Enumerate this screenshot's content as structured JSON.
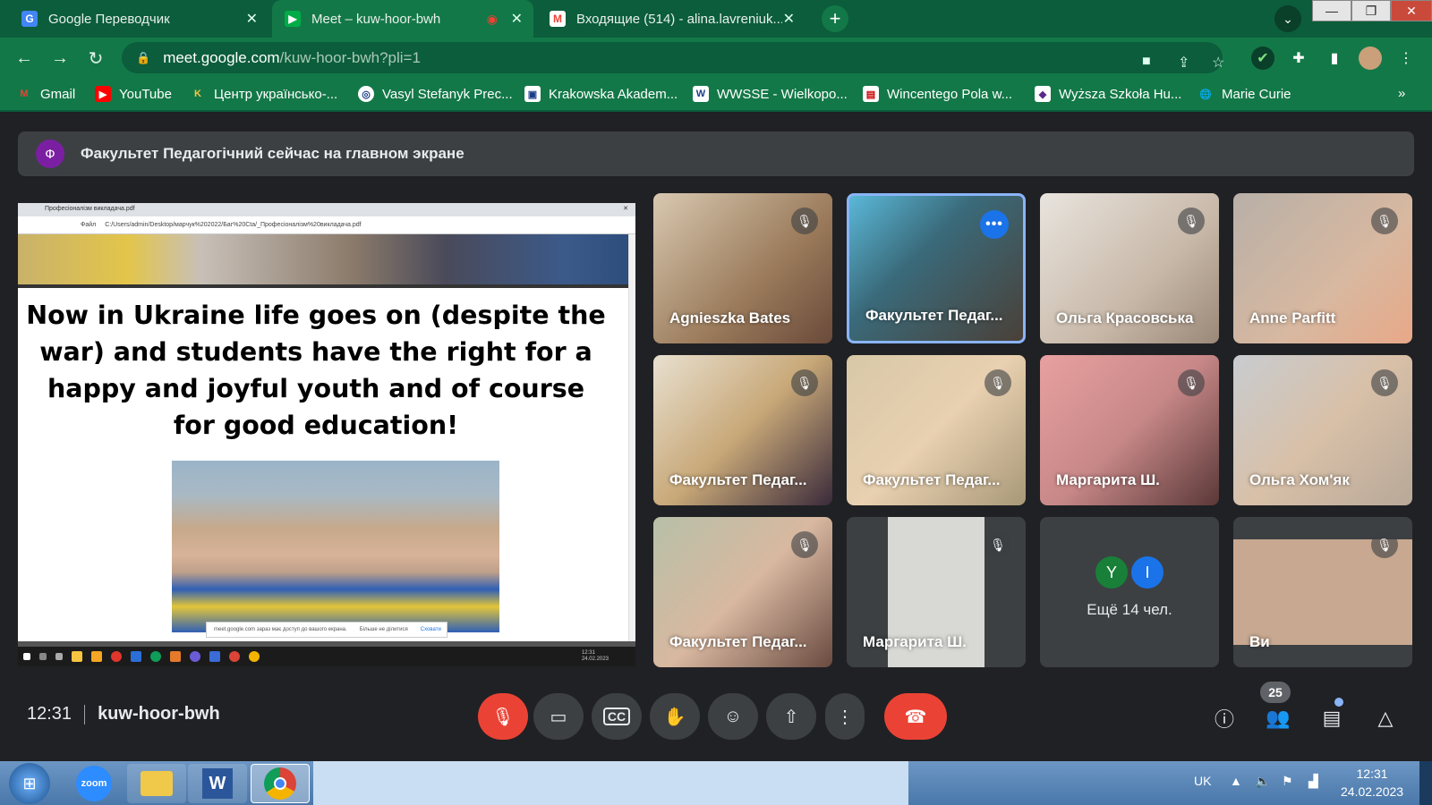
{
  "browser": {
    "tabs": [
      {
        "title": "Google Переводчик",
        "icon_color": "#4285f4"
      },
      {
        "title": "Meet – kuw-hoor-bwh",
        "icon_color": "#00ac47"
      },
      {
        "title": "Входящие (514) - alina.lavreniuk...",
        "icon_color": "#ea4335"
      }
    ],
    "url_host": "meet.google.com",
    "url_path": "/kuw-hoor-bwh?pli=1",
    "bookmarks": [
      "Gmail",
      "YouTube",
      "Центр українсько-...",
      "Vasyl Stefanyk Prec...",
      "Krakowska Akadem...",
      "WWSSE - Wielkopo...",
      "Wincentego Pola w...",
      "Wyższa Szkoła Hu...",
      "Marie Curie"
    ]
  },
  "meet": {
    "banner_initial": "Ф",
    "banner_text": "Факультет Педагогічний сейчас на главном экране",
    "presentation": {
      "tab_title": "Професіоналізм викладача.pdf",
      "file_label": "Файл",
      "path": "C:/Users/admin/Desktop/марчук%202022/Баг%20Сtа/_Професіоналізм%20викладача.pdf",
      "slide_text": "Now in Ukraine life goes on (despite the war) and students have the right  for a happy and joyful youth and of course for  good education!",
      "notice": "meet.google.com зараз має доступ до вашого екрана.",
      "notice_btn1": "Більше не ділитися",
      "notice_btn2": "Сховати",
      "time": "12:31",
      "date": "24.02.2023"
    },
    "participants": [
      {
        "name": "Agnieszka Bates"
      },
      {
        "name": "Факультет Педаг..."
      },
      {
        "name": "Ольга Красовська"
      },
      {
        "name": "Anne Parfitt"
      },
      {
        "name": "Факультет Педаг..."
      },
      {
        "name": "Факультет Педаг..."
      },
      {
        "name": "Маргарита Ш."
      },
      {
        "name": "Ольга Хом'як"
      },
      {
        "name": "Факультет Педаг..."
      },
      {
        "name": "Маргарита Ш."
      },
      {
        "name": "Ви"
      }
    ],
    "more": {
      "initials": [
        "Y",
        "I"
      ],
      "label": "Ещё 14 чел."
    },
    "time": "12:31",
    "meeting_code": "kuw-hoor-bwh",
    "participant_count": "25"
  },
  "taskbar": {
    "lang": "UK",
    "time": "12:31",
    "date": "24.02.2023",
    "zoom_label": "zoom"
  }
}
